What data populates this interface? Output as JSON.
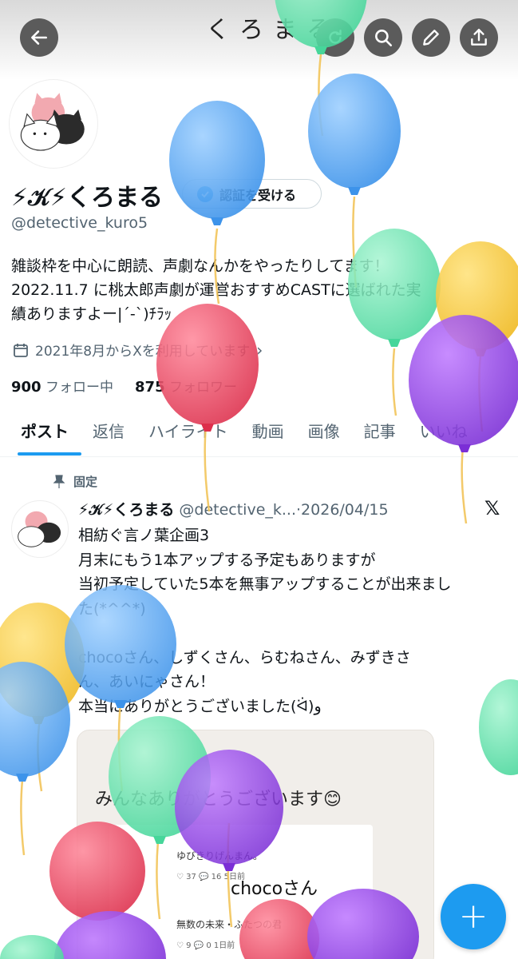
{
  "header": {
    "title": "くろまる",
    "back_icon": "back-arrow-icon",
    "actions": [
      "refresh-icon",
      "search-icon",
      "edit-icon",
      "share-icon"
    ]
  },
  "profile": {
    "display_name": "⚡𝒦⚡くろまる",
    "verify_label": "認証を受ける",
    "handle": "@detective_kuro5",
    "bio_line1": "雑談枠を中心に朗読、声劇なんかをやったりしてます！",
    "bio_line2": "2022.11.7 に桃太郎声劇が運営おすすめCASTに選ばれた実",
    "bio_line3": "績ありますよー|´-`)ﾁﾗｯ",
    "joined": "2021年8月からXを利用しています",
    "following_count": "900",
    "following_label": "フォロー中",
    "followers_count": "875",
    "followers_label": "フォロワー"
  },
  "tabs": [
    "ポスト",
    "返信",
    "ハイライト",
    "動画",
    "画像",
    "記事",
    "いいね"
  ],
  "post": {
    "pinned_label": "固定",
    "author": "⚡𝒦⚡くろまる",
    "meta": "@detective_k...·2026/04/15",
    "body": "相紡ぐ言ノ葉企画3\n月末にもう1本アップする予定もありますが\n当初予定していた5本を無事アップすることが出来まし\nた(*^^*)\n\nchocoさん、しずくさん、らむねさん、みずきさ\nん、あいにゃさん！\n本当にありがとうございました(ᐛ)و",
    "media": {
      "title": "みんなありがとうございます😊",
      "item1": "ゆびきりげんまん。",
      "item1_stats": "♡ 37   💬 16   5日前",
      "item2": "無数の未来・ふたつの君",
      "item2_stats": "♡ 9   💬 0   1日前",
      "overlay": "chocoさん"
    }
  },
  "fab_label": "+",
  "colors": {
    "accent": "#1d9bf0",
    "header_button": "#5b5b5b",
    "balloon_blue": "#4a9ff0",
    "balloon_green": "#5de0a8",
    "balloon_yellow": "#f4c430",
    "balloon_red": "#e8405a",
    "balloon_purple": "#8b3fe0"
  }
}
